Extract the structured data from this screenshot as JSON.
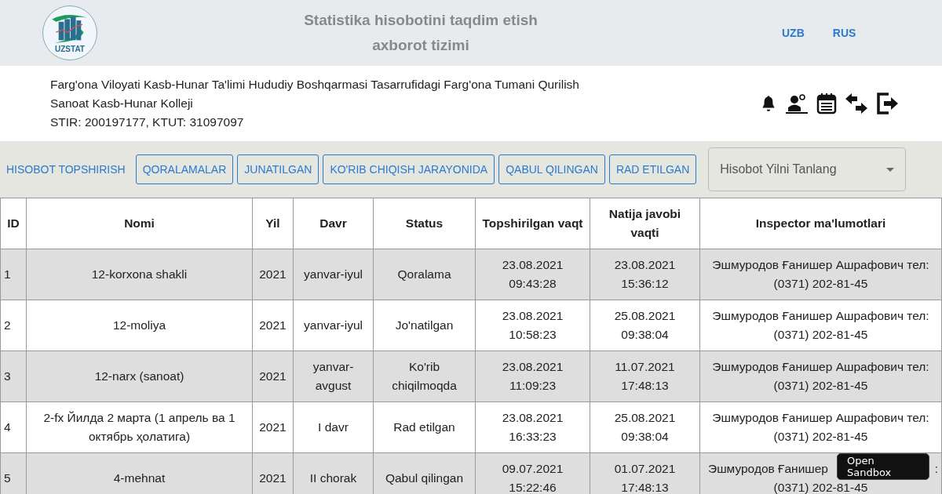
{
  "header": {
    "logo_text": "UZSTAT",
    "title": "Statistika hisobotini taqdim etish axborot tizimi",
    "languages": [
      {
        "label": "UZB"
      },
      {
        "label": "RUS"
      }
    ]
  },
  "organization": {
    "name": "Farg'ona Viloyati Kasb-Hunar Ta'limi Hududiy Boshqarmasi Tasarrufidagi Farg'ona Tumani Qurilish Sanoat Kasb-Hunar Kolleji",
    "ids": "STIR: 200197177, KTUT: 31097097"
  },
  "nav": {
    "title": "HISOBOT TOPSHIRISH",
    "buttons": [
      "QORALAMALAR",
      "JUNATILGAN",
      "KO'RIB CHIQISH JARAYONIDA",
      "QABUL QILINGAN",
      "RAD ETILGAN"
    ],
    "year_select": {
      "placeholder": "Hisobot Yilni Tanlang"
    }
  },
  "table": {
    "columns": [
      "ID",
      "Nomi",
      "Yil",
      "Davr",
      "Status",
      "Topshirilgan vaqt",
      "Natija javobi vaqti",
      "Inspector ma'lumotlari"
    ],
    "rows": [
      [
        "1",
        "12-korxona shakli",
        "2021",
        "yanvar-iyul",
        "Qoralama",
        "23.08.2021 09:43:28",
        "23.08.2021 15:36:12",
        "Эшмуродов Ғанишер Ашрафович тел: (0371) 202-81-45"
      ],
      [
        "2",
        "12-moliya",
        "2021",
        "yanvar-iyul",
        "Jo'natilgan",
        "23.08.2021 10:58:23",
        "25.08.2021 09:38:04",
        "Эшмуродов Ғанишер Ашрафович тел: (0371) 202-81-45"
      ],
      [
        "3",
        "12-narx (sanoat)",
        "2021",
        "yanvar-avgust",
        "Ko'rib chiqilmoqda",
        "23.08.2021 11:09:23",
        "11.07.2021 17:48:13",
        "Эшмуродов Ғанишер Ашрафович тел: (0371) 202-81-45"
      ],
      [
        "4",
        "2-fx Йилда 2 марта (1 апрель ва 1 октябрь ҳолатига)",
        "2021",
        "I davr",
        "Rad etilgan",
        "23.08.2021 16:33:23",
        "25.08.2021 09:38:04",
        "Эшмуродов Ғанишер Ашрафович тел: (0371) 202-81-45"
      ],
      [
        "5",
        "4-mehnat",
        "2021",
        "II chorak",
        "Qabul qilingan",
        "09.07.2021 15:22:46",
        "01.07.2021 17:48:13",
        [
          "Эшмуродов Ғанишер",
          ":",
          "(0371) 202-81-45"
        ]
      ]
    ]
  },
  "sandbox_badge": {
    "label": "Open Sandbox"
  }
}
